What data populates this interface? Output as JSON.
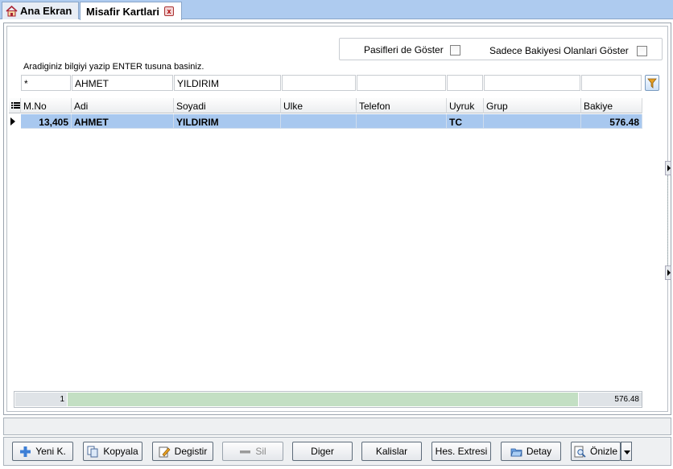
{
  "tabs": [
    {
      "label": "Ana Ekran",
      "icon": "home-icon"
    },
    {
      "label": "Misafir Kartlari",
      "icon": "close-icon",
      "close_glyph": "x"
    }
  ],
  "options": {
    "pasif_label": "Pasifleri de Göster",
    "bakiye_label": "Sadece Bakiyesi Olanlari Göster"
  },
  "hint": "Aradiginiz bilgiyi yazip ENTER tusuna basiniz.",
  "filters": {
    "no": "*",
    "adi": "AHMET",
    "soyadi": "YILDIRIM",
    "ulke": "",
    "telefon": "",
    "uyruk": "",
    "grup": "",
    "bakiye": ""
  },
  "columns": {
    "no": "M.No",
    "adi": "Adi",
    "soyadi": "Soyadi",
    "ulke": "Ulke",
    "telefon": "Telefon",
    "uyruk": "Uyruk",
    "grup": "Grup",
    "bakiye": "Bakiye"
  },
  "rows": [
    {
      "no": "13,405",
      "adi": "AHMET",
      "soyadi": "YILDIRIM",
      "ulke": "",
      "telefon": "",
      "uyruk": "TC",
      "grup": "",
      "bakiye": "576.48"
    }
  ],
  "summary": {
    "count": "1",
    "total": "576.48"
  },
  "buttons": {
    "yeni": "Yeni K.",
    "kopyala": "Kopyala",
    "degistir": "Degistir",
    "sil": "Sil",
    "diger": "Diger",
    "kalislar": "Kalislar",
    "hes_extresi": "Hes. Extresi",
    "detay": "Detay",
    "onizle": "Önizle"
  },
  "colors": {
    "selected_row": "#a8c8ef",
    "tab_strip": "#aecbef",
    "summary_bar": "#c3dfc3"
  }
}
